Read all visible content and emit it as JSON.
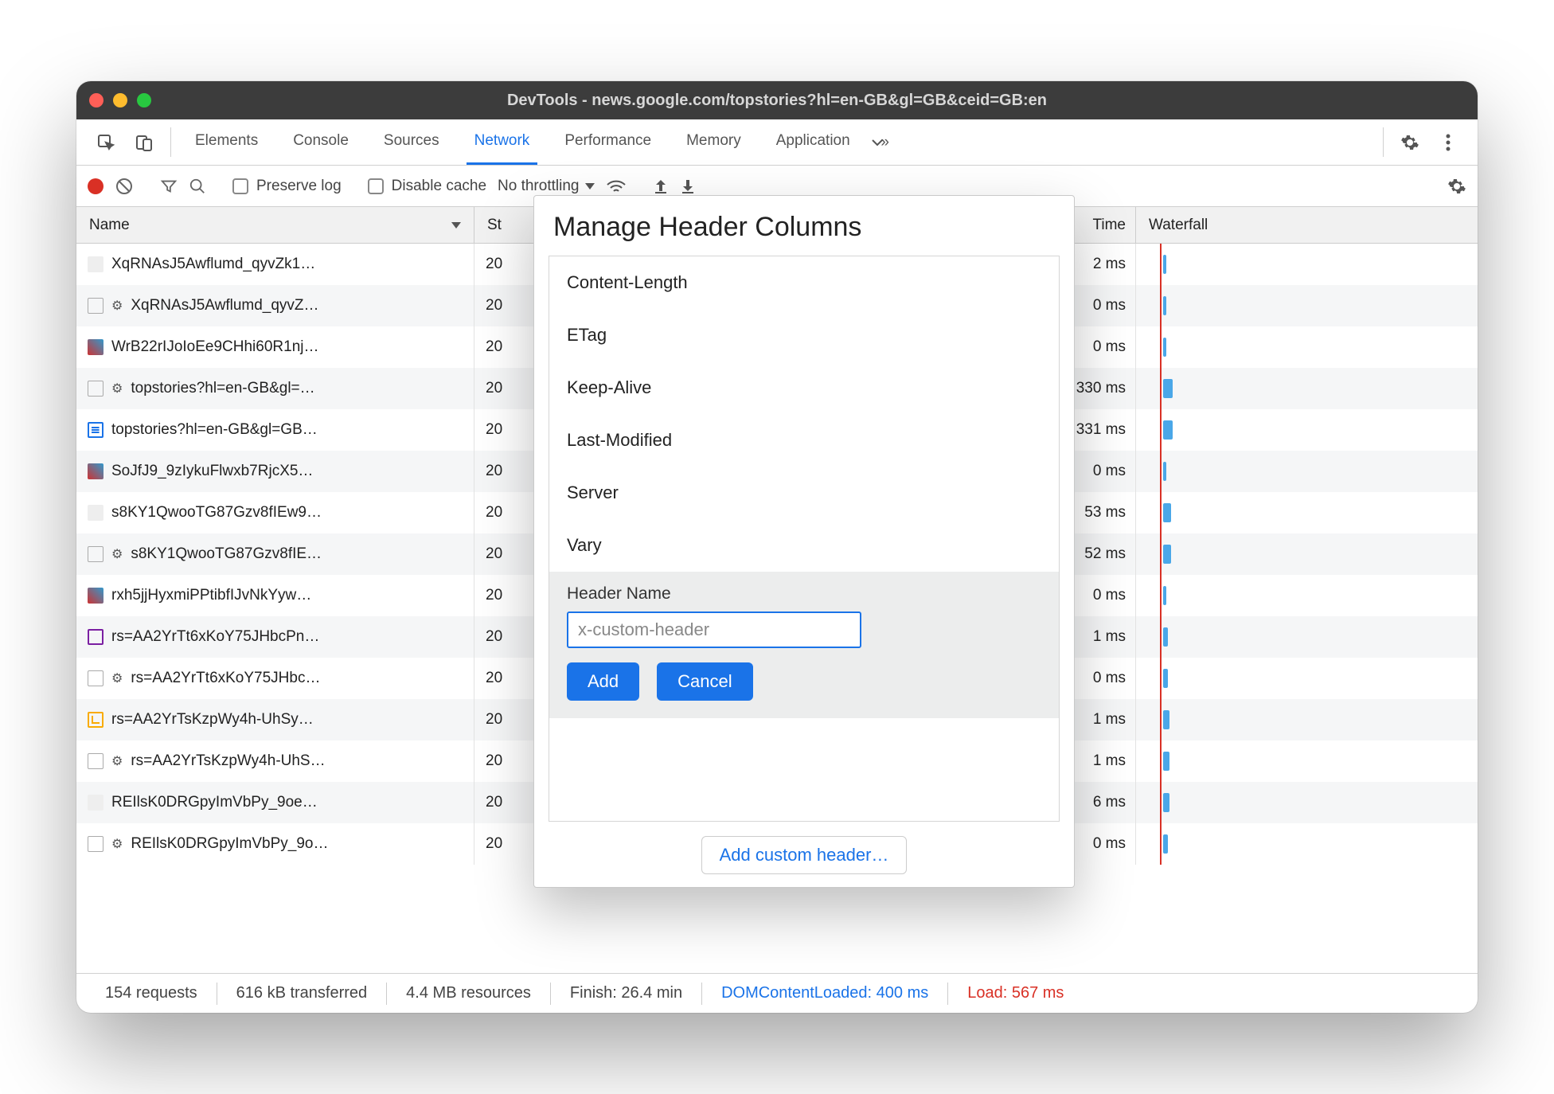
{
  "window": {
    "title": "DevTools - news.google.com/topstories?hl=en-GB&gl=GB&ceid=GB:en"
  },
  "tabs": {
    "items": [
      "Elements",
      "Console",
      "Sources",
      "Network",
      "Performance",
      "Memory",
      "Application"
    ],
    "active": "Network"
  },
  "toolbar": {
    "preserve_log": "Preserve log",
    "disable_cache": "Disable cache",
    "throttling": "No throttling"
  },
  "columns": {
    "name": "Name",
    "status": "St",
    "time": "Time",
    "waterfall": "Waterfall"
  },
  "requests": [
    {
      "icon": "bar",
      "gear": false,
      "name": "XqRNAsJ5Awflumd_qyvZk1…",
      "status": "20",
      "time": "2 ms",
      "wf": 4
    },
    {
      "icon": "plain",
      "gear": true,
      "name": "XqRNAsJ5Awflumd_qyvZ…",
      "status": "20",
      "time": "0 ms",
      "wf": 4
    },
    {
      "icon": "img",
      "gear": false,
      "name": "WrB22rIJoIoEe9CHhi60R1nj…",
      "status": "20",
      "time": "0 ms",
      "wf": 4
    },
    {
      "icon": "plain",
      "gear": true,
      "name": "topstories?hl=en-GB&gl=…",
      "status": "20",
      "time": "330 ms",
      "wf": 12
    },
    {
      "icon": "doc",
      "gear": false,
      "name": "topstories?hl=en-GB&gl=GB…",
      "status": "20",
      "time": "331 ms",
      "wf": 12
    },
    {
      "icon": "img",
      "gear": false,
      "name": "SoJfJ9_9zIykuFlwxb7RjcX5…",
      "status": "20",
      "time": "0 ms",
      "wf": 4
    },
    {
      "icon": "bar",
      "gear": false,
      "name": "s8KY1QwooTG87Gzv8fIEw9…",
      "status": "20",
      "time": "53 ms",
      "wf": 10
    },
    {
      "icon": "plain",
      "gear": true,
      "name": "s8KY1QwooTG87Gzv8fIE…",
      "status": "20",
      "time": "52 ms",
      "wf": 10
    },
    {
      "icon": "img",
      "gear": false,
      "name": "rxh5jjHyxmiPPtibfIJvNkYyw…",
      "status": "20",
      "time": "0 ms",
      "wf": 4
    },
    {
      "icon": "purple",
      "gear": false,
      "name": "rs=AA2YrTt6xKoY75JHbcPn…",
      "status": "20",
      "time": "1 ms",
      "wf": 6
    },
    {
      "icon": "plain",
      "gear": true,
      "name": "rs=AA2YrTt6xKoY75JHbc…",
      "status": "20",
      "time": "0 ms",
      "wf": 6
    },
    {
      "icon": "js",
      "gear": false,
      "name": "rs=AA2YrTsKzpWy4h-UhSy…",
      "status": "20",
      "time": "1 ms",
      "wf": 8
    },
    {
      "icon": "plain",
      "gear": true,
      "name": "rs=AA2YrTsKzpWy4h-UhS…",
      "status": "20",
      "time": "1 ms",
      "wf": 8
    },
    {
      "icon": "bar",
      "gear": false,
      "name": "REIlsK0DRGpyImVbPy_9oe…",
      "status": "20",
      "time": "6 ms",
      "wf": 8
    },
    {
      "icon": "plain",
      "gear": true,
      "name": "REIlsK0DRGpyImVbPy_9o…",
      "status": "20",
      "time": "0 ms",
      "wf": 6
    }
  ],
  "statusbar": {
    "requests": "154 requests",
    "transferred": "616 kB transferred",
    "resources": "4.4 MB resources",
    "finish": "Finish: 26.4 min",
    "dcl": "DOMContentLoaded: 400 ms",
    "load": "Load: 567 ms"
  },
  "popup": {
    "title": "Manage Header Columns",
    "headers": [
      "Content-Length",
      "ETag",
      "Keep-Alive",
      "Last-Modified",
      "Server",
      "Vary"
    ],
    "form_label": "Header Name",
    "placeholder": "x-custom-header",
    "add": "Add",
    "cancel": "Cancel",
    "add_custom": "Add custom header…"
  }
}
